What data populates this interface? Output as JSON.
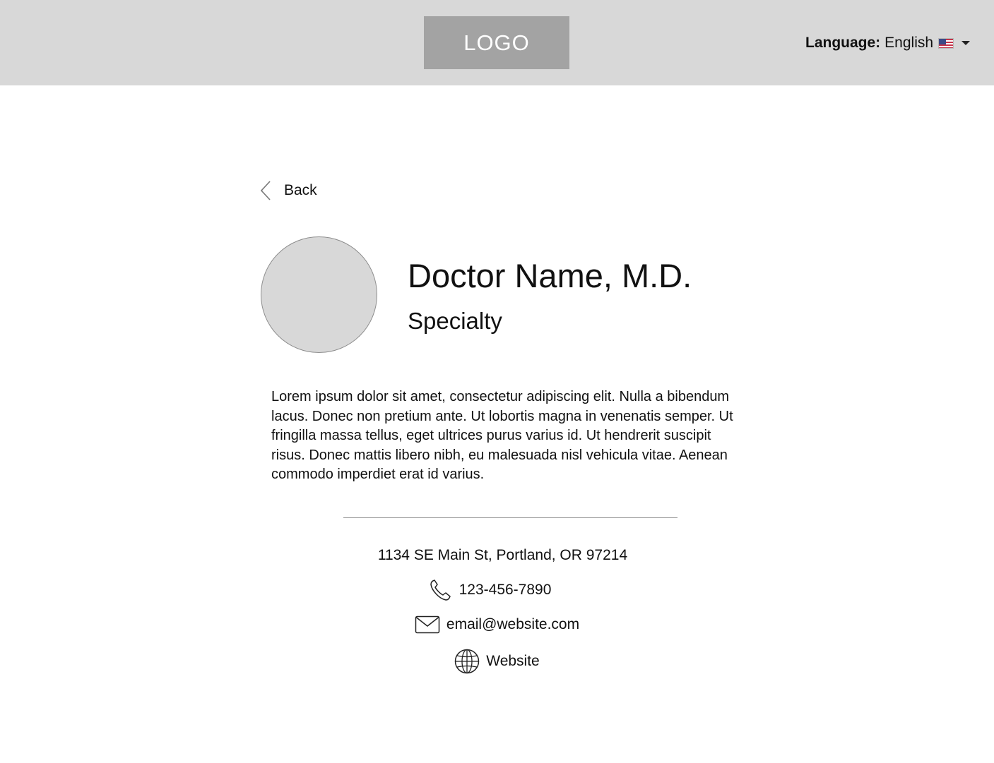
{
  "header": {
    "logo_text": "LOGO",
    "language_label": "Language:",
    "language_value": "English",
    "language_flag": "us-flag-icon",
    "background_color": "#d8d8d8",
    "logo_color": "#a3a3a3"
  },
  "nav": {
    "back_label": "Back"
  },
  "profile": {
    "name": "Doctor Name, M.D.",
    "specialty": "Specialty",
    "bio": "Lorem ipsum dolor sit amet, consectetur adipiscing elit. Nulla a bibendum lacus. Donec non pretium ante. Ut lobortis magna in venenatis semper. Ut fringilla massa tellus, eget ultrices purus varius id. Ut hendrerit suscipit risus. Donec mattis libero nibh, eu malesuada nisl vehicula vitae. Aenean commodo imperdiet erat id varius."
  },
  "contact": {
    "address": "1134 SE Main St, Portland, OR 97214",
    "phone": "123-456-7890",
    "email": "email@website.com",
    "website": "Website"
  }
}
